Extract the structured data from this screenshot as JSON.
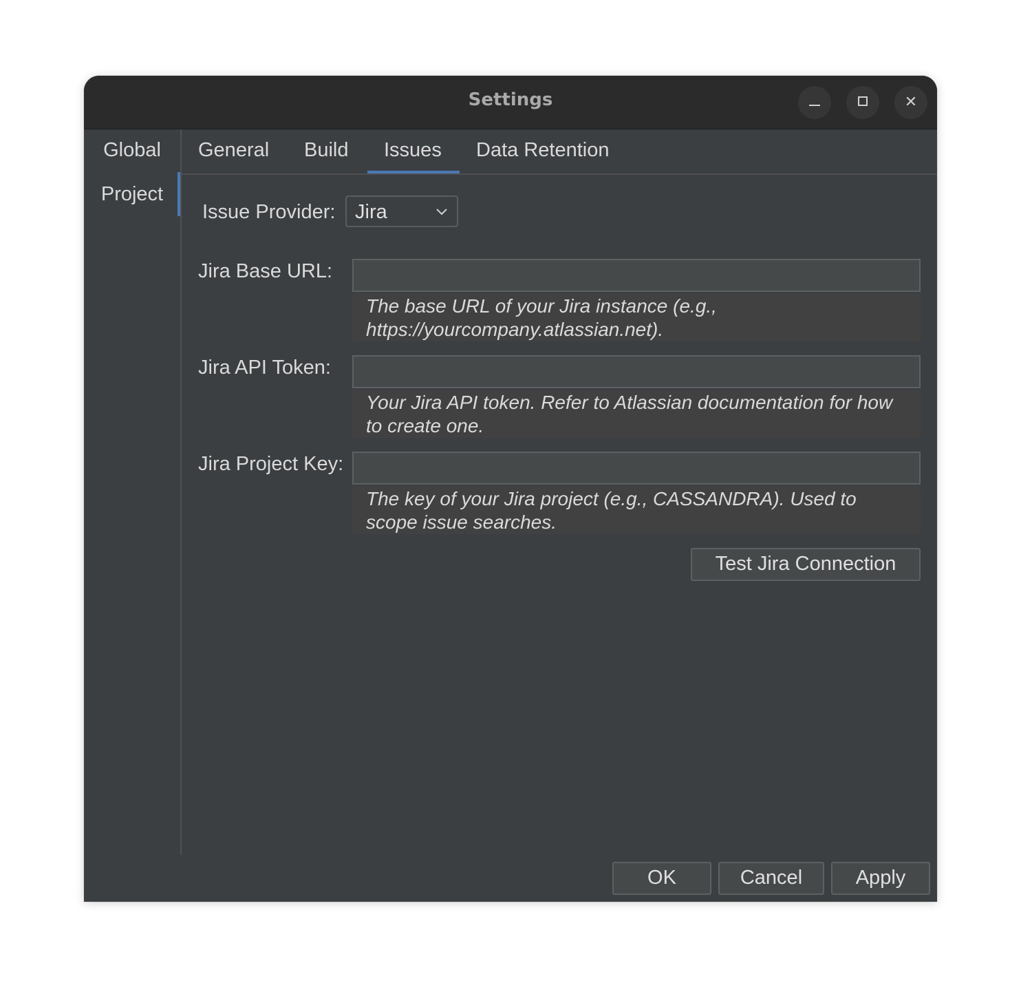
{
  "window": {
    "title": "Settings",
    "controls": {
      "minimize": "minimize-icon",
      "maximize": "maximize-icon",
      "close": "close-icon"
    }
  },
  "sidebar": {
    "items": [
      {
        "label": "Global",
        "selected": false
      },
      {
        "label": "Project",
        "selected": true
      }
    ]
  },
  "tabs": [
    {
      "label": "General",
      "selected": false
    },
    {
      "label": "Build",
      "selected": false
    },
    {
      "label": "Issues",
      "selected": true
    },
    {
      "label": "Data Retention",
      "selected": false
    }
  ],
  "issues": {
    "provider_label": "Issue Provider:",
    "provider_value": "Jira",
    "fields": [
      {
        "label": "Jira Base URL:",
        "value": "",
        "help": "The base URL of your Jira instance (e.g., https://yourcompany.atlassian.net)."
      },
      {
        "label": "Jira API Token:",
        "value": "",
        "help": "Your Jira API token. Refer to Atlassian documentation for how to create one."
      },
      {
        "label": "Jira Project Key:",
        "value": "",
        "help": "The key of your Jira project (e.g., CASSANDRA). Used to scope issue searches."
      }
    ],
    "test_button": "Test Jira Connection"
  },
  "footer": {
    "ok": "OK",
    "cancel": "Cancel",
    "apply": "Apply"
  },
  "colors": {
    "background": "#3c3f41",
    "titlebar": "#2b2b2b",
    "accent": "#4a7ab5",
    "text": "#dadada"
  }
}
